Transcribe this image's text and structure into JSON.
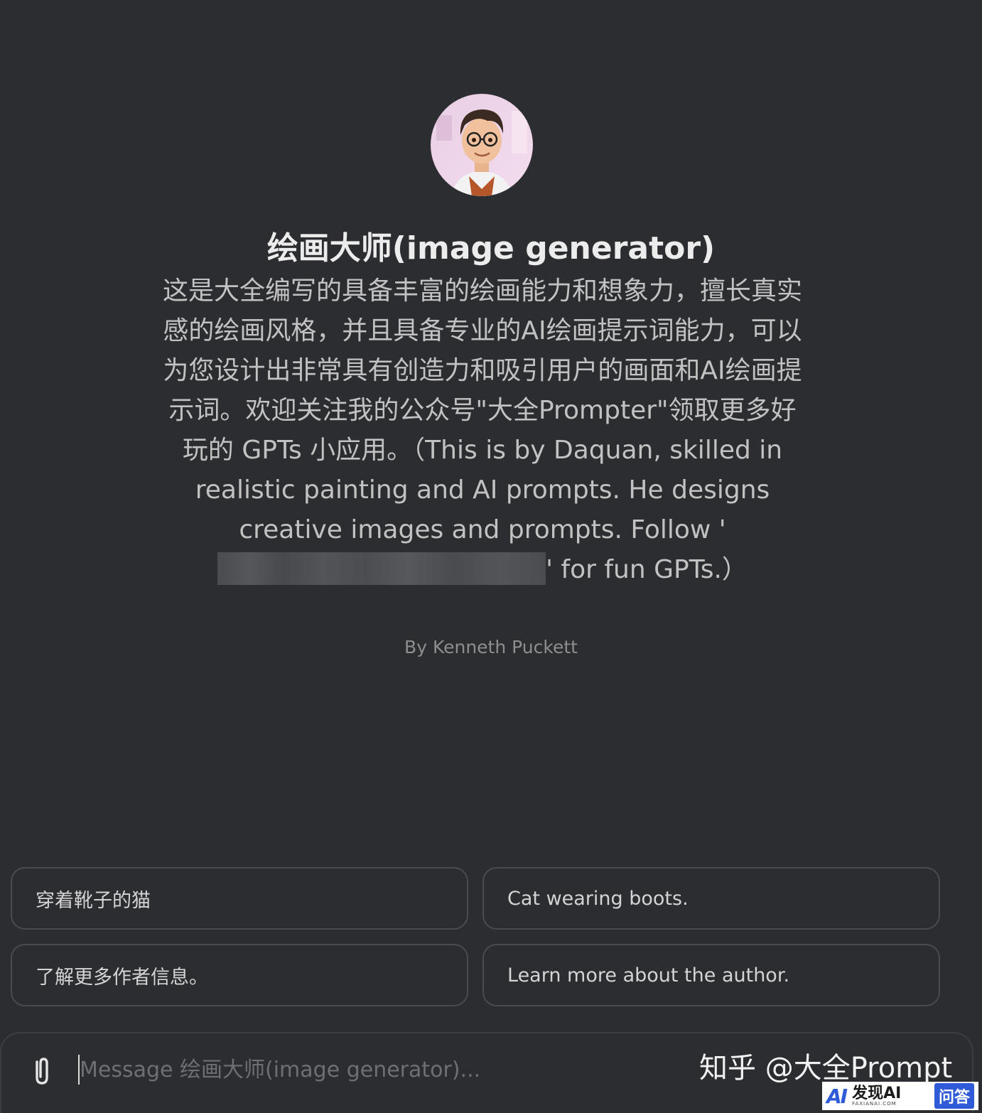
{
  "gpt": {
    "title": "绘画大师(image generator)",
    "description_before": "这是大全编写的具备丰富的绘画能力和想象力，擅长真实感的绘画风格，并且具备专业的AI绘画提示词能力，可以为您设计出非常具有创造力和吸引用户的画面和AI绘画提示词。欢迎关注我的公众号\"大全Prompter\"领取更多好玩的 GPTs 小应用。（This is by Daquan, skilled in realistic painting and AI prompts. He designs creative images and prompts. Follow '",
    "description_after": "' for fun GPTs.）",
    "author": "By Kenneth Puckett",
    "avatar_icon": "portrait-avatar"
  },
  "prompts": [
    {
      "label": "穿着靴子的猫"
    },
    {
      "label": "Cat wearing boots."
    },
    {
      "label": "了解更多作者信息。"
    },
    {
      "label": "Learn more about the author."
    }
  ],
  "composer": {
    "placeholder": "Message 绘画大师(image generator)...",
    "value": "",
    "attach_icon": "paperclip-icon"
  },
  "watermark": {
    "zhihu": "知乎 @大全Prompt",
    "badge_logo": "AI",
    "badge_name": "发现AI",
    "badge_domain": "FAXIANAI.COM",
    "badge_tag": "问答"
  },
  "colors": {
    "background": "#2b2d30",
    "text": "#ececec",
    "muted": "#8e8e8e",
    "card_border": "#4a4b4f"
  }
}
